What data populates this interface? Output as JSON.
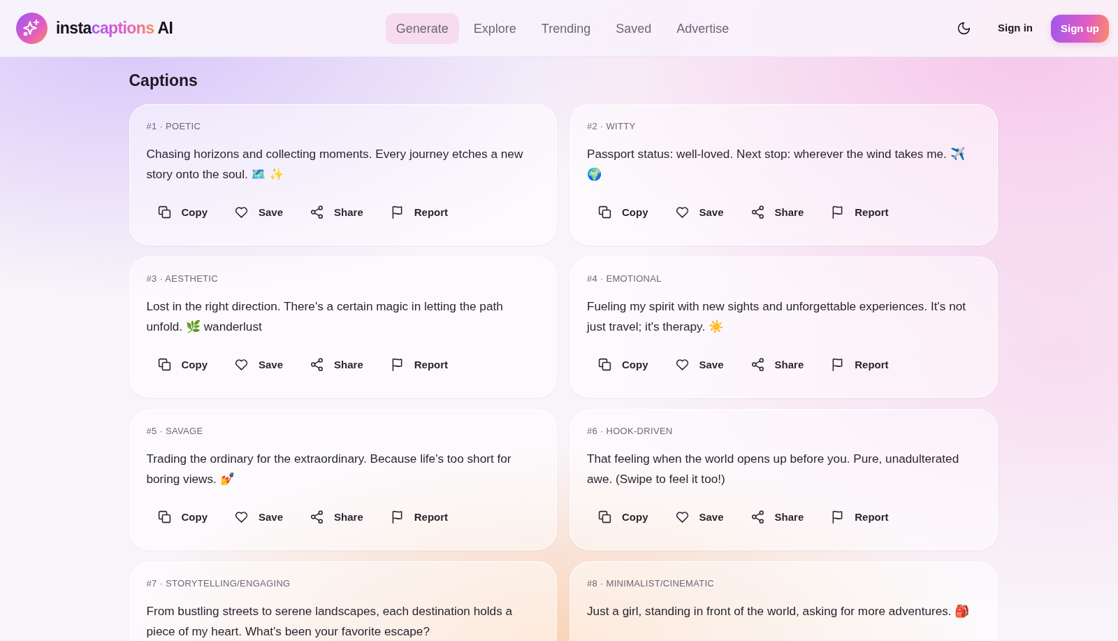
{
  "header": {
    "logo": {
      "parts": [
        {
          "text": "insta",
          "kind": "plain"
        },
        {
          "text": "captions",
          "kind": "gradient"
        },
        {
          "text": " AI",
          "kind": "plain"
        }
      ]
    },
    "nav": [
      {
        "label": "Generate",
        "selected": true
      },
      {
        "label": "Explore",
        "selected": false
      },
      {
        "label": "Trending",
        "selected": false
      },
      {
        "label": "Saved",
        "selected": false
      },
      {
        "label": "Advertise",
        "selected": false
      }
    ],
    "sign_in": "Sign in",
    "sign_up": "Sign up"
  },
  "section_title": "Captions",
  "captions": [
    {
      "label": "#1 · POETIC",
      "text": "Chasing horizons and collecting moments. Every journey etches a new story onto the soul. 🗺️ ✨",
      "actions": [
        {
          "kind": "copy",
          "label": "Copy"
        },
        {
          "kind": "save",
          "label": "Save"
        },
        {
          "kind": "share",
          "label": "Share"
        },
        {
          "kind": "report",
          "label": "Report"
        }
      ]
    },
    {
      "label": "#2 · WITTY",
      "text": "Passport status: well-loved. Next stop: wherever the wind takes me. ✈️ 🌍",
      "actions": [
        {
          "kind": "copy",
          "label": "Copy"
        },
        {
          "kind": "save",
          "label": "Save"
        },
        {
          "kind": "share",
          "label": "Share"
        },
        {
          "kind": "report",
          "label": "Report"
        }
      ]
    },
    {
      "label": "#3 · AESTHETIC",
      "text": "Lost in the right direction. There's a certain magic in letting the path unfold. 🌿 wanderlust",
      "actions": [
        {
          "kind": "copy",
          "label": "Copy"
        },
        {
          "kind": "save",
          "label": "Save"
        },
        {
          "kind": "share",
          "label": "Share"
        },
        {
          "kind": "report",
          "label": "Report"
        }
      ]
    },
    {
      "label": "#4 · EMOTIONAL",
      "text": "Fueling my spirit with new sights and unforgettable experiences. It's not just travel; it's therapy. ☀️",
      "actions": [
        {
          "kind": "copy",
          "label": "Copy"
        },
        {
          "kind": "save",
          "label": "Save"
        },
        {
          "kind": "share",
          "label": "Share"
        },
        {
          "kind": "report",
          "label": "Report"
        }
      ]
    },
    {
      "label": "#5 · SAVAGE",
      "text": "Trading the ordinary for the extraordinary. Because life's too short for boring views. 💅",
      "actions": [
        {
          "kind": "copy",
          "label": "Copy"
        },
        {
          "kind": "save",
          "label": "Save"
        },
        {
          "kind": "share",
          "label": "Share"
        },
        {
          "kind": "report",
          "label": "Report"
        }
      ]
    },
    {
      "label": "#6 · HOOK-DRIVEN",
      "text": "That feeling when the world opens up before you. Pure, unadulterated awe. (Swipe to feel it too!)",
      "actions": [
        {
          "kind": "copy",
          "label": "Copy"
        },
        {
          "kind": "save",
          "label": "Save"
        },
        {
          "kind": "share",
          "label": "Share"
        },
        {
          "kind": "report",
          "label": "Report"
        }
      ]
    },
    {
      "label": "#7 · STORYTELLING/ENGAGING",
      "text": "From bustling streets to serene landscapes, each destination holds a piece of my heart. What's been your favorite escape?"
    },
    {
      "label": "#8 · MINIMALIST/CINEMATIC",
      "text": "Just a girl, standing in front of the world, asking for more adventures. 🎒"
    }
  ]
}
